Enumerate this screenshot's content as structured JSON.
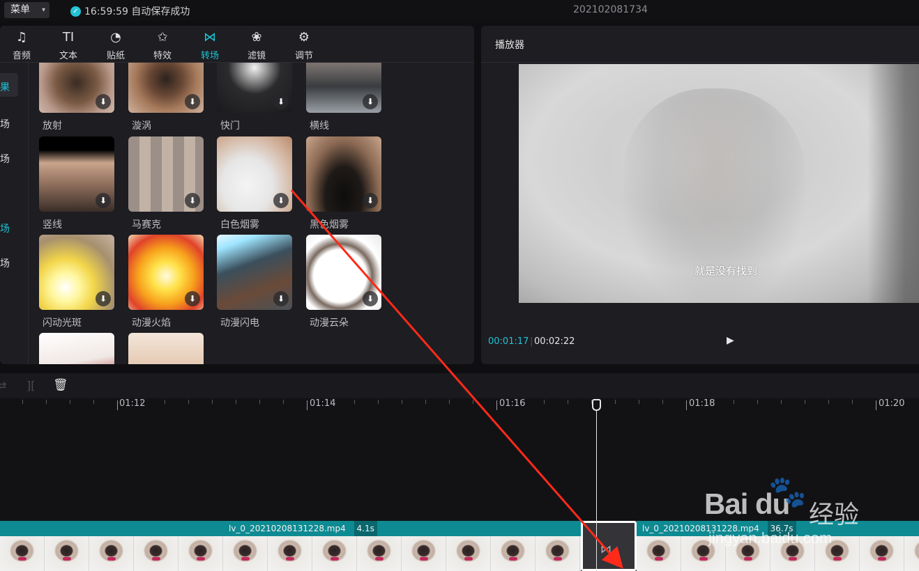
{
  "topbar": {
    "menu_label": "菜单",
    "save_status": "16:59:59 自动保存成功",
    "project_title": "202102081734"
  },
  "toolbar": {
    "items": [
      {
        "icon": "music-icon",
        "label": "音频"
      },
      {
        "icon": "text-icon",
        "label": "文本"
      },
      {
        "icon": "sticker-icon",
        "label": "贴纸"
      },
      {
        "icon": "effects-icon",
        "label": "特效"
      },
      {
        "icon": "transition-icon",
        "label": "转场",
        "active": true
      },
      {
        "icon": "filter-icon",
        "label": "滤镜"
      },
      {
        "icon": "adjust-icon",
        "label": "调节"
      }
    ]
  },
  "categories": [
    "果",
    "场",
    "场",
    "场",
    "场"
  ],
  "effects": [
    {
      "label": "放射"
    },
    {
      "label": "漩涡"
    },
    {
      "label": "快门"
    },
    {
      "label": "横线"
    },
    {
      "label": "竖线"
    },
    {
      "label": "马赛克"
    },
    {
      "label": "白色烟雾"
    },
    {
      "label": "黑色烟雾"
    },
    {
      "label": "闪动光斑"
    },
    {
      "label": "动漫火焰"
    },
    {
      "label": "动漫闪电"
    },
    {
      "label": "动漫云朵"
    }
  ],
  "player": {
    "title": "播放器",
    "subtitle": "就是没有找到",
    "current_time": "00:01:17",
    "total_time": "00:02:22"
  },
  "timeline": {
    "ticks": [
      "01:12",
      "01:14",
      "01:16",
      "01:18",
      "01:20"
    ],
    "clip1": {
      "name": "lv_0_20210208131228.mp4",
      "duration": "4.1s"
    },
    "clip2": {
      "name": "lv_0_20210208131228.mp4",
      "duration": "36.7s"
    }
  },
  "watermark": {
    "brand": "Bai du",
    "cn": "经验",
    "url": "jingyan.baidu.com"
  },
  "colors": {
    "accent": "#1ec4d6",
    "clip": "#0e8a92",
    "annotation_arrow": "#ff2a1a"
  }
}
